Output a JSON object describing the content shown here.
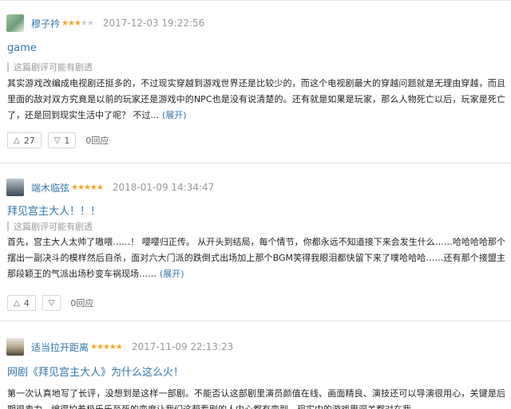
{
  "reviews": [
    {
      "author": "穆子衿",
      "rating": 3,
      "time": "2017-12-03 19:22:56",
      "title": "game",
      "warning": "这篇剧评可能有剧透",
      "body": "其实游戏改编成电视剧还挺多的，不过现实穿越到游戏世界还是比较少的，而这个电视剧最大的穿越问题就是无理由穿越，而且里面的敌对双方究竟是以前的玩家还是游戏中的NPC也是没有说清楚的。还有就是如果是玩家，那么人物死亡以后，玩家是死亡了，还是回到现实生活中了呢？ 不过...",
      "expand": "(展开)",
      "up": "27",
      "down": "1",
      "replies": "0回应"
    },
    {
      "author": "端木临弦",
      "rating": 5,
      "time": "2018-01-09 14:34:47",
      "title": "拜见宫主大人！！！",
      "warning": "这篇剧评可能有剧透",
      "body": "首先，宫主大人太帅了嗷喂……！ 嘤嘤归正传。 从开头到结局，每个情节，你都永远不知道接下来会发生什么……哈哈哈哈那个摆出一副决斗的模样然后自杀，面对六大门派的跌倒式出场加上那个BGM笑得我眼泪都快留下来了噗哈哈哈……还有那个接盟主那段颖王的气派出场秒变车祸现场……",
      "expand": "(展开)",
      "up": "4",
      "replies": "0回应"
    },
    {
      "author": "适当拉开距离",
      "rating": 5,
      "time": "2017-11-09 22:13:23",
      "title": "网剧《拜见宫主大人》为什么这么火！",
      "body": "第一次认真地写了长评，没想到是这样一部剧。不能否认这部剧里演员颜值在线、画面精良、演技还可以导演很用心，关键是后期很卖力，编得拍着极乐乐至死的变度让我们这帮看剧的人内心都有变到。现实中的游戏里洞关都对在我"
    }
  ],
  "colors": {
    "link": "#3377aa",
    "star": "#f5a623",
    "meta": "#999999"
  },
  "icons": {
    "up": "triangle-up-icon",
    "down": "triangle-down-icon"
  }
}
